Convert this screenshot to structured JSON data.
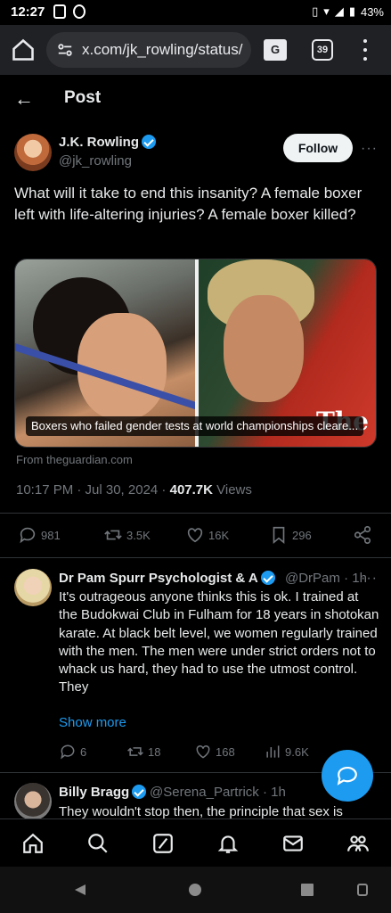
{
  "status_bar": {
    "time": "12:27",
    "battery": "43%"
  },
  "browser": {
    "url": "x.com/jk_rowling/status/",
    "tab_count": "39",
    "translate_label": "G"
  },
  "header": {
    "title": "Post"
  },
  "post": {
    "author_name": "J.K. Rowling",
    "author_handle": "@jk_rowling",
    "follow_label": "Follow",
    "more": "···",
    "text": "What will it take to end this insanity? A  female boxer left with life-altering injuries? A female boxer killed?",
    "media_caption": "Boxers who failed gender tests at world championships cleare...",
    "media_logo": "The",
    "source": "From theguardian.com",
    "time": "10:17 PM · Jul 30, 2024 · ",
    "views_count": "407.7K",
    "views_label": " Views",
    "stats": {
      "replies": "981",
      "reposts": "3.5K",
      "likes": "16K",
      "bookmarks": "296"
    }
  },
  "replies": [
    {
      "name": "Dr Pam Spurr Psychologist & A",
      "handle_time": "@DrPam · 1h",
      "more": "···",
      "text": "It's outrageous anyone thinks this is ok. I trained at the Budokwai Club in Fulham for 18 years in shotokan karate. At black belt level, we women regularly trained with the men. The men were under strict orders not to whack us hard, they had to use the utmost control.\nThey",
      "show_more": "Show more",
      "stats": {
        "replies": "6",
        "reposts": "18",
        "likes": "168",
        "views": "9.6K"
      }
    },
    {
      "name": "Billy Bragg",
      "handle_time": "@Serena_Partrick · 1h",
      "text": "They wouldn't stop then, the principle that sex is"
    }
  ]
}
